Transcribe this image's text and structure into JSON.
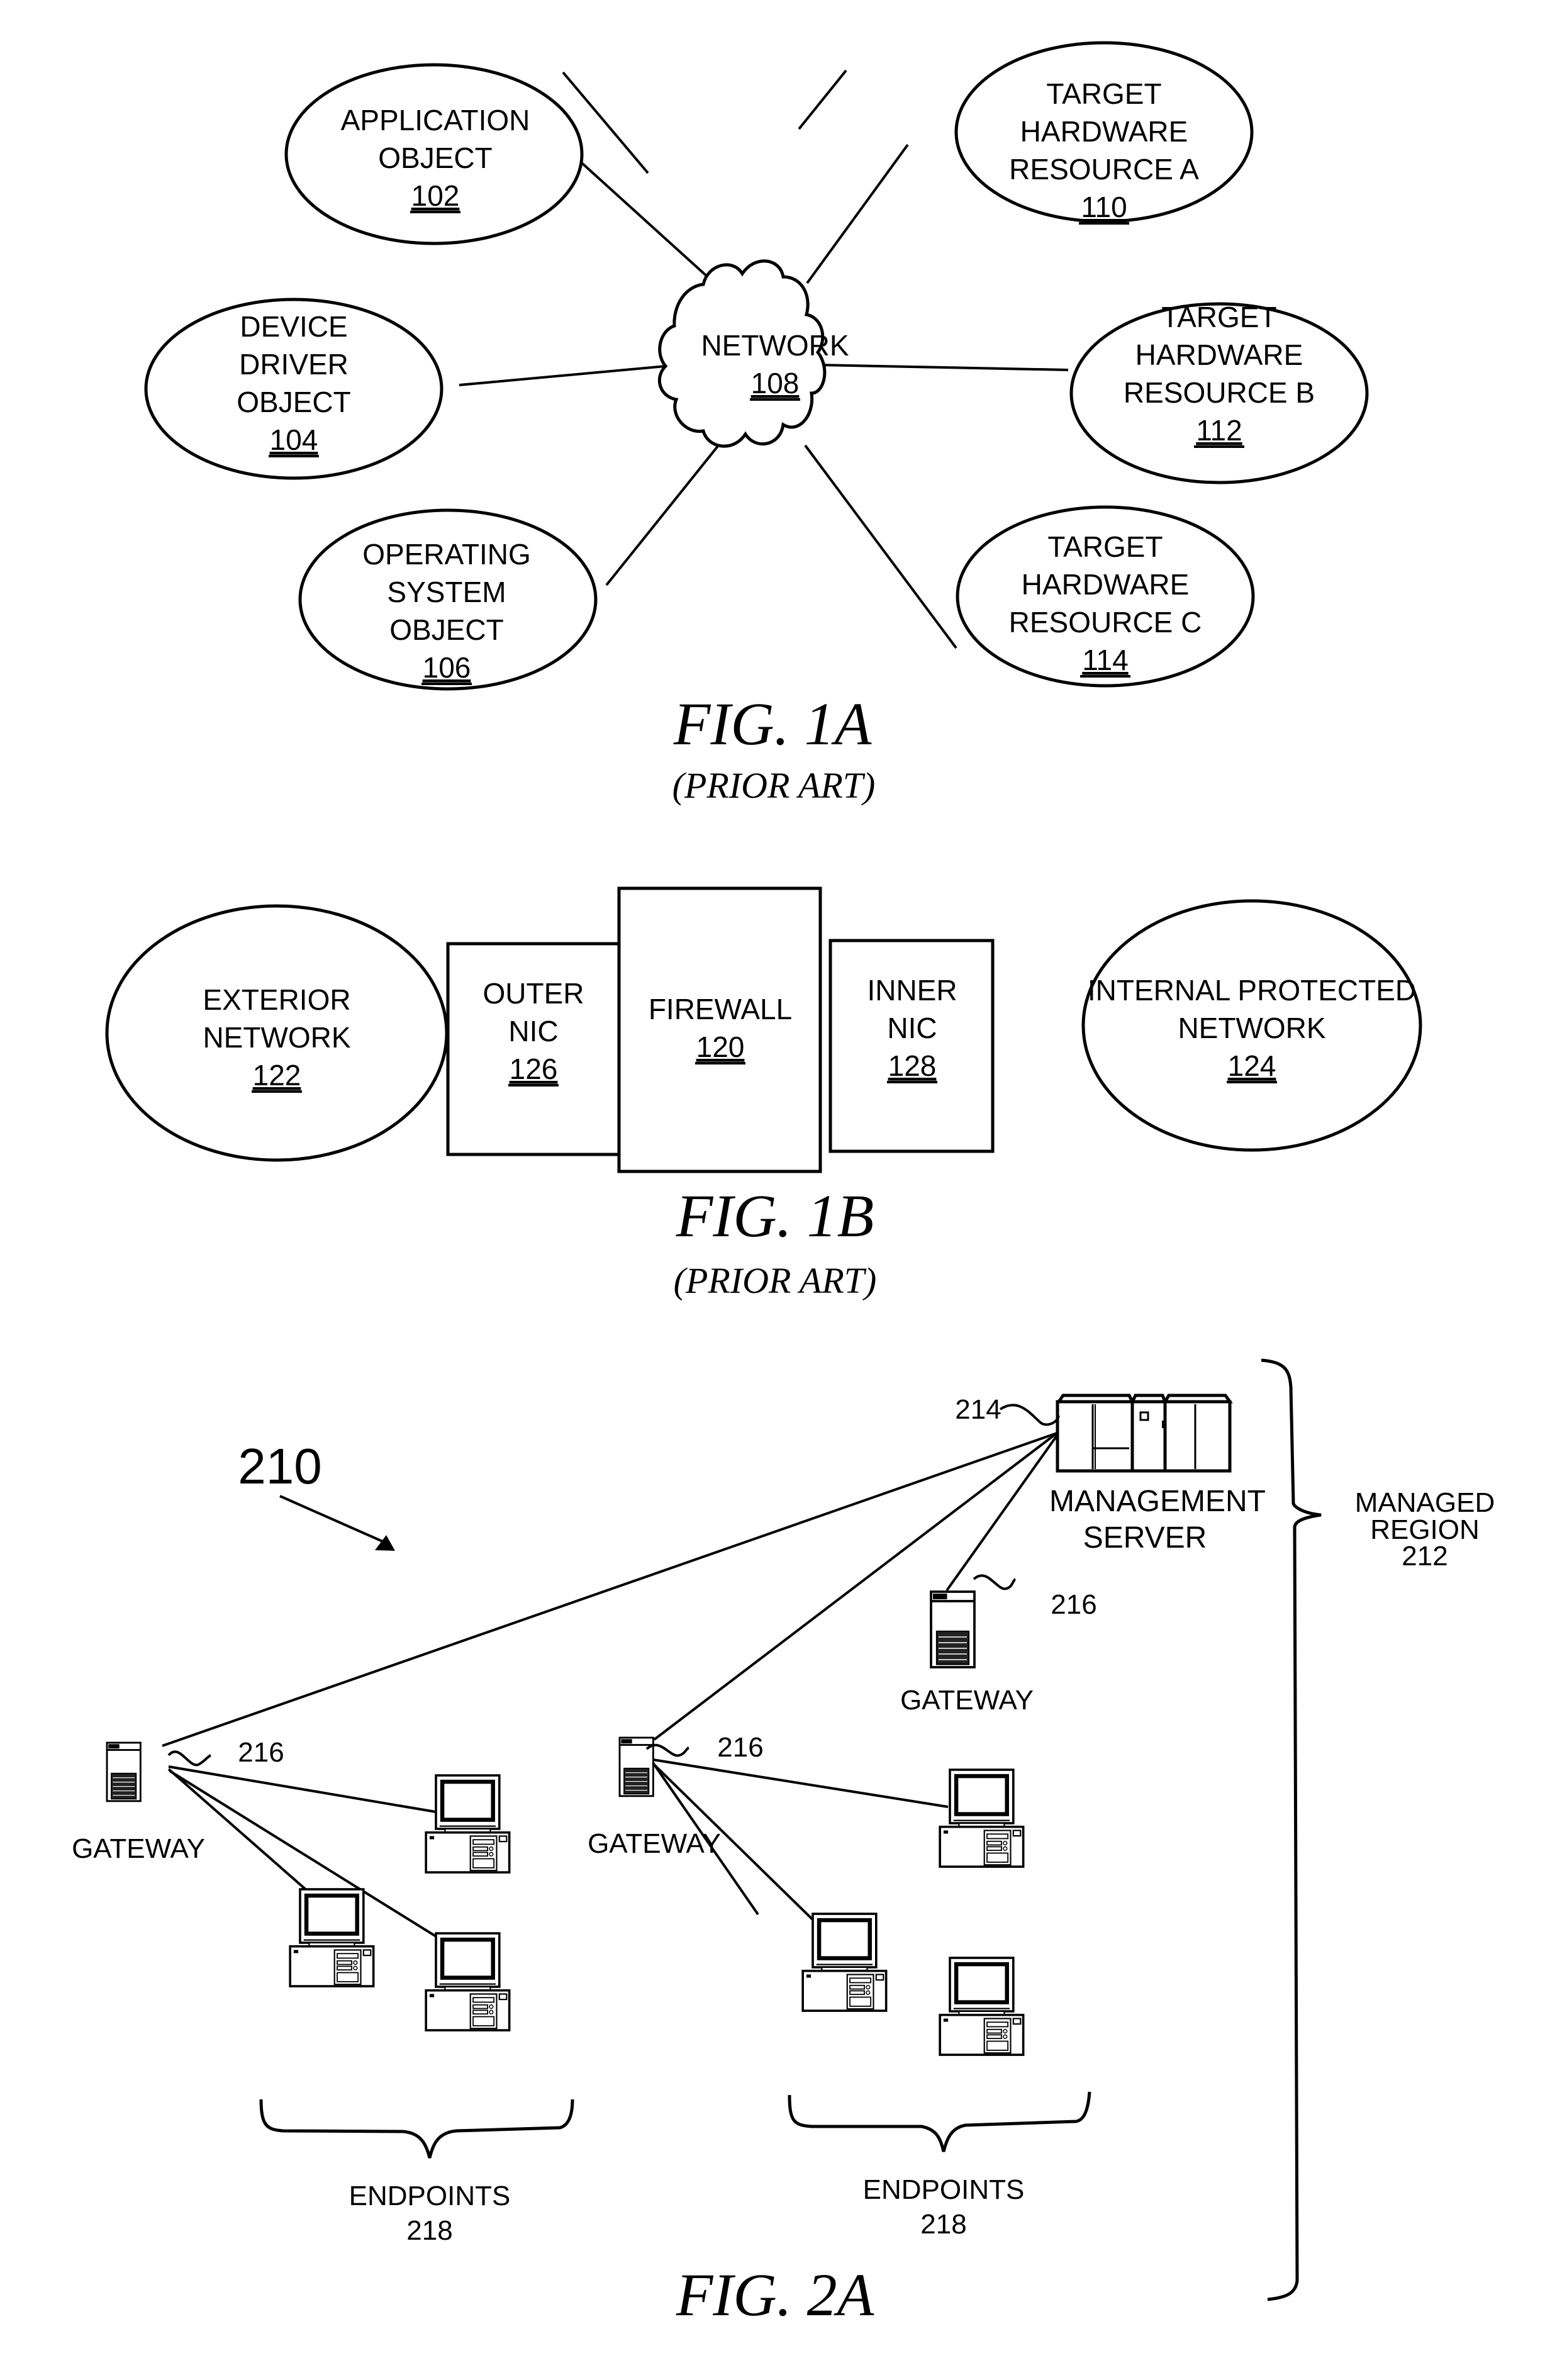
{
  "fig1a": {
    "nodes": [
      {
        "id": "application-object",
        "lines": [
          "APPLICATION",
          "OBJECT"
        ],
        "ref": "102"
      },
      {
        "id": "device-driver-object",
        "lines": [
          "DEVICE",
          "DRIVER",
          "OBJECT"
        ],
        "ref": "104"
      },
      {
        "id": "operating-system-object",
        "lines": [
          "OPERATING",
          "SYSTEM",
          "OBJECT"
        ],
        "ref": "106"
      },
      {
        "id": "network",
        "lines": [
          "NETWORK"
        ],
        "ref": "108"
      },
      {
        "id": "target-hardware-resource-a",
        "lines": [
          "TARGET",
          "HARDWARE",
          "RESOURCE A"
        ],
        "ref": "110"
      },
      {
        "id": "target-hardware-resource-b",
        "lines": [
          "TARGET",
          "HARDWARE",
          "RESOURCE B"
        ],
        "ref": "112"
      },
      {
        "id": "target-hardware-resource-c",
        "lines": [
          "TARGET",
          "HARDWARE",
          "RESOURCE C"
        ],
        "ref": "114"
      }
    ],
    "caption": "FIG. 1A",
    "subcaption": "(PRIOR ART)"
  },
  "fig1b": {
    "nodes": [
      {
        "id": "exterior-network",
        "lines": [
          "EXTERIOR",
          "NETWORK"
        ],
        "ref": "122"
      },
      {
        "id": "outer-nic",
        "lines": [
          "OUTER",
          "NIC"
        ],
        "ref": "126"
      },
      {
        "id": "firewall",
        "lines": [
          "FIREWALL"
        ],
        "ref": "120"
      },
      {
        "id": "inner-nic",
        "lines": [
          "INNER",
          "NIC"
        ],
        "ref": "128"
      },
      {
        "id": "internal-protected-network",
        "lines": [
          "INTERNAL PROTECTED",
          "NETWORK"
        ],
        "ref": "124"
      }
    ],
    "caption": "FIG. 1B",
    "subcaption": "(PRIOR ART)"
  },
  "fig2a": {
    "system_ref": "210",
    "management_server": {
      "ref": "214",
      "lines": [
        "MANAGEMENT",
        "SERVER"
      ]
    },
    "gateways": [
      {
        "label": "GATEWAY",
        "ref": "216"
      },
      {
        "label": "GATEWAY",
        "ref": "216"
      },
      {
        "label": "GATEWAY",
        "ref": "216"
      }
    ],
    "endpoint_groups": [
      {
        "label": "ENDPOINTS",
        "ref": "218"
      },
      {
        "label": "ENDPOINTS",
        "ref": "218"
      }
    ],
    "managed_region": {
      "lines": [
        "MANAGED",
        "REGION"
      ],
      "ref": "212"
    },
    "caption": "FIG. 2A"
  }
}
